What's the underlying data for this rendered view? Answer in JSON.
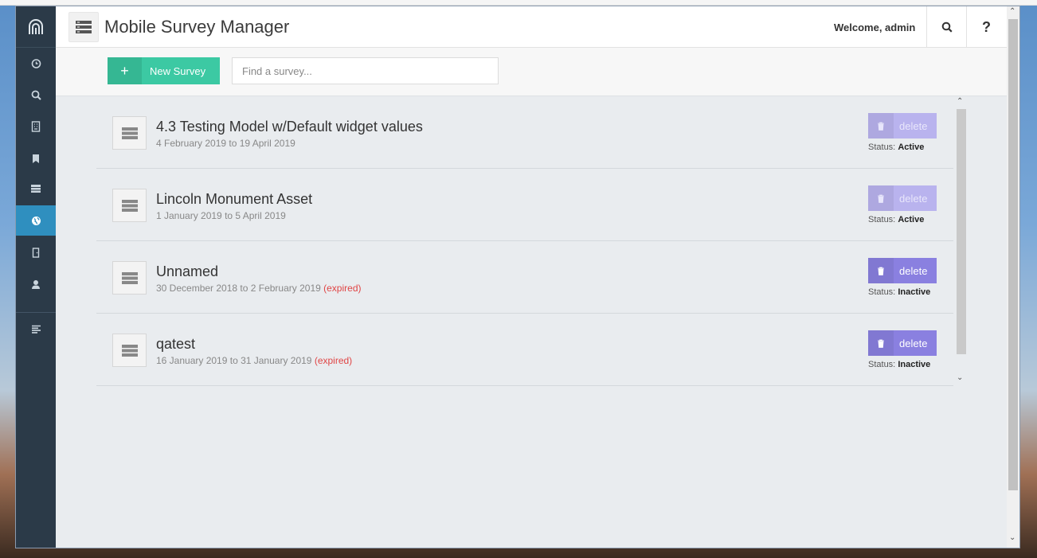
{
  "app": {
    "title": "Mobile Survey Manager",
    "welcome": "Welcome, admin",
    "help_label": "?"
  },
  "toolbar": {
    "new_label": "New Survey",
    "new_plus": "+",
    "search_placeholder": "Find a survey..."
  },
  "sidebar": {
    "active_index": 5,
    "icons": [
      "logo-icon",
      "clock-icon",
      "search-icon",
      "building-icon",
      "bookmark-icon",
      "server-icon",
      "globe-icon",
      "door-icon",
      "user-icon",
      "align-left-icon"
    ]
  },
  "surveys": [
    {
      "name": "4.3 Testing Model w/Default widget values",
      "dates": "4 February 2019 to 19 April 2019",
      "expired": "",
      "delete_label": "delete",
      "status_label": "Status:",
      "status": "Active"
    },
    {
      "name": "Lincoln Monument Asset",
      "dates": "1 January 2019 to 5 April 2019",
      "expired": "",
      "delete_label": "delete",
      "status_label": "Status:",
      "status": "Active"
    },
    {
      "name": "Unnamed",
      "dates": "30 December 2018 to 2 February 2019",
      "expired": "(expired)",
      "delete_label": "delete",
      "status_label": "Status:",
      "status": "Inactive"
    },
    {
      "name": "qatest",
      "dates": "16 January 2019 to 31 January 2019",
      "expired": "(expired)",
      "delete_label": "delete",
      "status_label": "Status:",
      "status": "Inactive"
    }
  ],
  "colors": {
    "sidebar": "#2b3a48",
    "sidebar_active": "#2f8fbf",
    "new_button": "#3cc9a3",
    "delete_active": "#8a80e0",
    "delete_disabled": "#b9b3ee",
    "expired": "#e04545"
  }
}
